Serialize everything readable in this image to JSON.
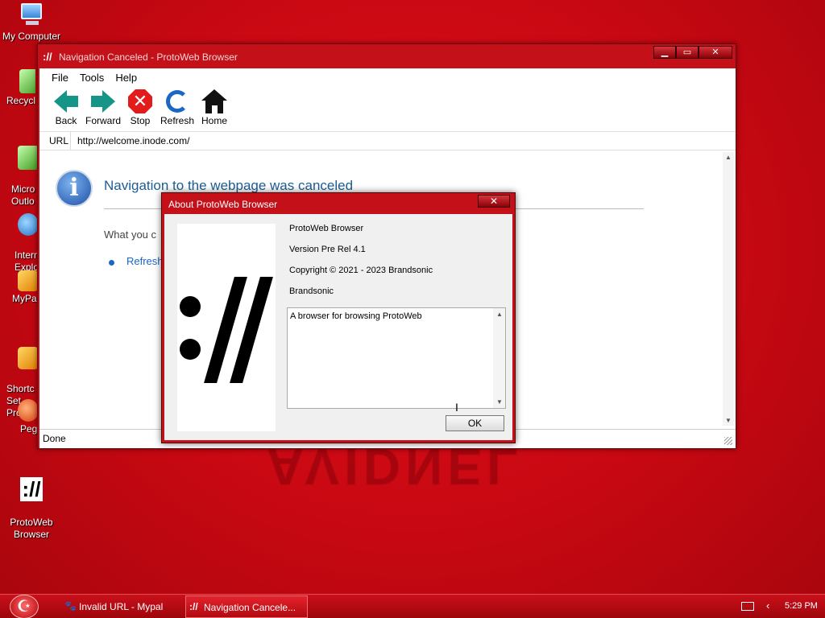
{
  "desktop": {
    "watermark": "AVIDNEL",
    "icons": [
      {
        "label": "My Computer"
      },
      {
        "label": "Recycl"
      },
      {
        "label": "Micro\nOutlo"
      },
      {
        "label": "Intern\nExplo"
      },
      {
        "label": "MyPa"
      },
      {
        "label": "Shortc\nSet Pro"
      },
      {
        "label": "Peg"
      },
      {
        "label": "ProtoWeb\nBrowser"
      }
    ]
  },
  "browser": {
    "title": "Navigation Canceled - ProtoWeb Browser",
    "title_icon": "://",
    "window_buttons": {
      "minimize": "▁",
      "maximize": "▭",
      "close": "✕"
    },
    "menu": [
      "File",
      "Tools",
      "Help"
    ],
    "toolbar": {
      "back": "Back",
      "forward": "Forward",
      "stop": "Stop",
      "refresh": "Refresh",
      "home": "Home"
    },
    "url_label": "URL",
    "url_value": "http://welcome.inode.com/",
    "page": {
      "heading": "Navigation to the webpage was canceled",
      "what": "What you c",
      "refresh_link": "Refresh"
    },
    "status": "Done"
  },
  "about_dialog": {
    "title": "About ProtoWeb Browser",
    "close": "✕",
    "product": "ProtoWeb Browser",
    "version": "Version Pre Rel 4.1",
    "copyright": "Copyright ©  2021 - 2023 Brandsonic",
    "company": "Brandsonic",
    "description": "A browser for browsing ProtoWeb",
    "ok": "OK"
  },
  "taskbar": {
    "tasks": [
      {
        "label": "Invalid URL - Mypal",
        "icon": "mypal-icon"
      },
      {
        "label": "Navigation Cancele...",
        "icon": "protoweb-icon"
      }
    ],
    "clock": "5:29 PM"
  },
  "colors": {
    "accent": "#c41019",
    "link": "#1a67c4",
    "heading": "#1d5c96"
  }
}
